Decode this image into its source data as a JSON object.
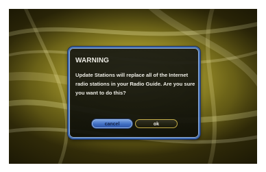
{
  "dialog": {
    "title": "WARNING",
    "message": "Update Stations will replace all of the Internet radio stations in your Radio Guide. Are you sure you want to do this?",
    "buttons": {
      "cancel_label": "cancel",
      "ok_label": "ok"
    }
  },
  "colors": {
    "background_gold": "#a89b2f",
    "dialog_border": "#3f6fc0",
    "cancel_button": "#3c6fd0",
    "ok_button_border": "#c9b04a"
  }
}
